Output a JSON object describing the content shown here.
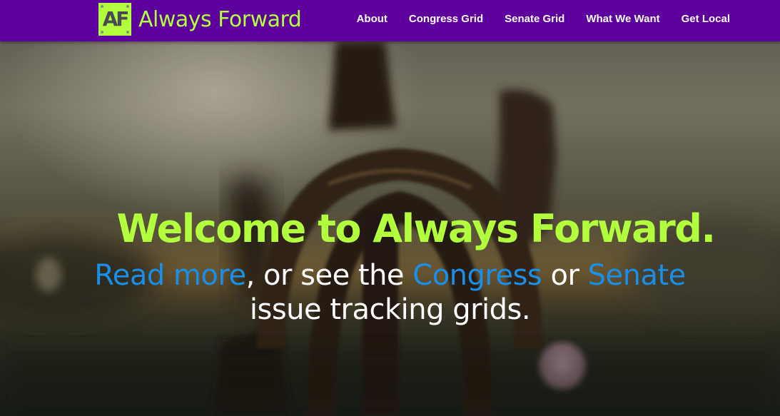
{
  "brand": {
    "logo_text": "AF",
    "name": "Always Forward"
  },
  "nav": {
    "items": [
      {
        "label": "About"
      },
      {
        "label": "Congress Grid"
      },
      {
        "label": "Senate Grid"
      },
      {
        "label": "What We Want"
      },
      {
        "label": "Get Local"
      }
    ]
  },
  "hero": {
    "title": "Welcome to Always Forward.",
    "link_read_more": "Read more",
    "text_1": ", or see the ",
    "link_congress": "Congress",
    "text_2": " or ",
    "link_senate": "Senate",
    "text_3": " issue tracking grids."
  },
  "colors": {
    "nav_bg": "#5e009e",
    "accent_green": "#b2ff3d",
    "link_blue": "#1a8fe8",
    "text_white": "#ffffff"
  },
  "icons": {
    "logo": "af-logo-icon"
  }
}
